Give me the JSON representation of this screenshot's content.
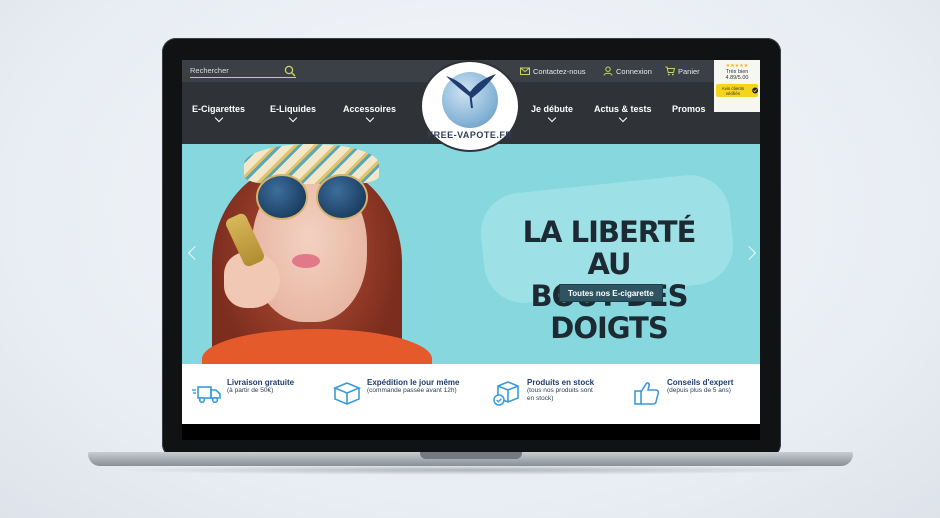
{
  "search": {
    "placeholder": "Rechercher"
  },
  "toplinks": {
    "contact": "Contactez-nous",
    "login": "Connexion",
    "cart": "Panier"
  },
  "rating": {
    "stars": "★★★★★",
    "label": "Très bien",
    "score": "4.89/5.00",
    "badge": "Avis clients vérifiés"
  },
  "logo": {
    "text": "FREE-VAPOTE.FR"
  },
  "nav": {
    "items": [
      {
        "label": "E-Cigarettes"
      },
      {
        "label": "E-Liquides"
      },
      {
        "label": "Accessoires"
      },
      {
        "label": "Je débute"
      },
      {
        "label": "Actus & tests"
      },
      {
        "label": "Promos"
      }
    ]
  },
  "hero": {
    "headline_line1": "LA LIBERTÉ AU",
    "headline_line2": "BOUT DES DOIGTS",
    "cta": "Toutes nos E-cigarette"
  },
  "features": [
    {
      "title": "Livraison gratuite",
      "subtitle": "(à partir de 50€)",
      "icon": "delivery-truck-icon"
    },
    {
      "title": "Expédition le jour même",
      "subtitle": "(commande passée avant 12h)",
      "icon": "shipping-box-icon"
    },
    {
      "title": "Produits en stock",
      "subtitle": "(tous nos produits sont",
      "subtitle2": "en stock)",
      "icon": "stock-box-icon"
    },
    {
      "title": "Conseils d'expert",
      "subtitle": "(depuis plus de 5 ans)",
      "icon": "thumbs-up-icon"
    }
  ],
  "colors": {
    "header": "#2f3338",
    "hero": "#86d8de",
    "accent": "#c9d35e",
    "feature_text": "#1f3c6e"
  }
}
